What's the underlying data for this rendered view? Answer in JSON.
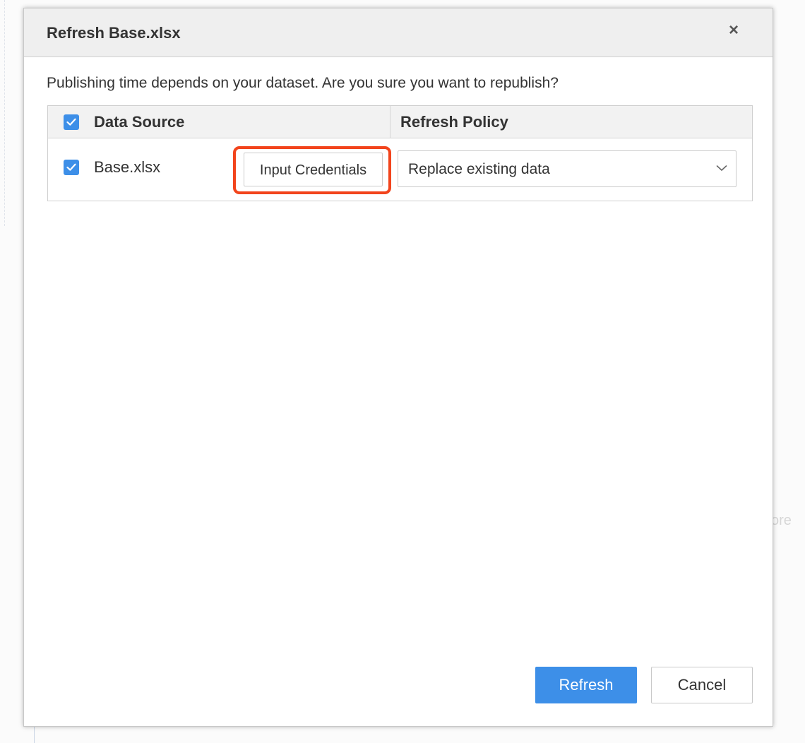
{
  "background": {
    "hint_text": "ore"
  },
  "dialog": {
    "title": "Refresh Base.xlsx",
    "close_icon": "×",
    "message": "Publishing time depends on your dataset. Are you sure you want to republish?",
    "table": {
      "headers": {
        "data_source": "Data Source",
        "refresh_policy": "Refresh Policy"
      },
      "rows": [
        {
          "checked": true,
          "source": "Base.xlsx",
          "credentials_label": "Input Credentials",
          "policy": "Replace existing data"
        }
      ]
    },
    "buttons": {
      "refresh": "Refresh",
      "cancel": "Cancel"
    }
  },
  "colors": {
    "accent": "#3d8fe8",
    "highlight": "#f2441c",
    "header_bg": "#efefef"
  },
  "icons": {
    "close": "close-icon",
    "check": "check-icon",
    "dropdown": "chevron-down-icon"
  }
}
